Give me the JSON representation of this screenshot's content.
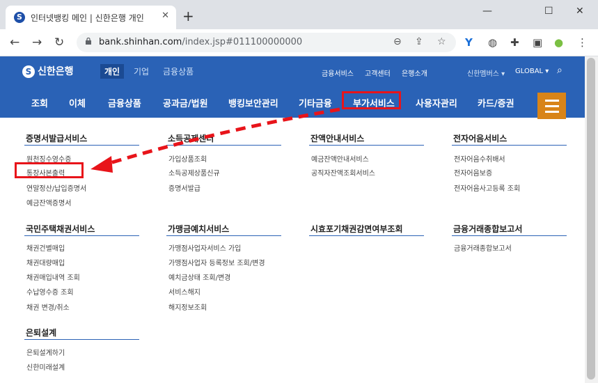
{
  "browser": {
    "tab_favicon_char": "S",
    "tab_title": "인터넷뱅킹 메인 | 신한은행 개인",
    "tab_close": "✕",
    "new_tab": "+",
    "minimize": "—",
    "maximize": "☐",
    "close": "✕",
    "back": "←",
    "forward": "→",
    "reload": "↻",
    "url_host": "bank.shinhan.com",
    "url_path": "/index.jsp#011100000000",
    "icons": [
      "zoom-icon",
      "share-icon",
      "star-icon",
      "extension-y-icon",
      "mouse-icon",
      "puzzle-icon",
      "sidebar-icon",
      "profile-icon",
      "menu-dots-icon"
    ]
  },
  "site": {
    "logo_text": "신한은행",
    "logo_mark": "S",
    "top_tabs": [
      "개인",
      "기업",
      "금융상품"
    ],
    "utility_links": [
      "금융서비스",
      "고객센터",
      "은행소개"
    ],
    "family_label": "신한멤버스 ▾",
    "global_label": "GLOBAL ▾",
    "search_icon": "⌕",
    "colors": {
      "brand": "#2a62b6",
      "highlight": "#e8141a",
      "menu_button": "#d88418"
    }
  },
  "gnb": {
    "items": [
      "조회",
      "이체",
      "금융상품",
      "공과금/법원",
      "뱅킹보안관리",
      "기타금융",
      "부가서비스",
      "사용자관리",
      "카드/증권"
    ]
  },
  "mega_menu": {
    "sections": [
      {
        "title": "증명서발급서비스",
        "links": [
          "원천징수영수증",
          "통장사본출력",
          "연말정산/납입증명서",
          "예금잔액증명서"
        ]
      },
      {
        "title": "소득공제센터",
        "links": [
          "가입상품조회",
          "소득공제상품신규",
          "증명서발급"
        ]
      },
      {
        "title": "잔액안내서비스",
        "links": [
          "예금잔액안내서비스",
          "공직자잔액조회서비스"
        ]
      },
      {
        "title": "전자어음서비스",
        "links": [
          "전자어음수취배서",
          "전자어음보증",
          "전자어음사고등록 조회"
        ]
      },
      {
        "title": "국민주택채권서비스",
        "links": [
          "채권건별매입",
          "채권대량매입",
          "채권매입내역 조회",
          "수납영수증 조회",
          "채권 변경/취소"
        ]
      },
      {
        "title": "가맹금예치서비스",
        "links": [
          "가맹점사업자서비스 가입",
          "가맹점사업자 등록정보 조회/변경",
          "예치금상태 조회/변경",
          "서비스해지",
          "해지정보조회"
        ]
      },
      {
        "title": "시효포기채권감면여부조회",
        "links": []
      },
      {
        "title": "금융거래종합보고서",
        "links": [
          "금융거래종합보고서"
        ]
      },
      {
        "title": "은퇴설계",
        "links": [
          "은퇴설계하기",
          "신한미래설계"
        ]
      }
    ]
  }
}
